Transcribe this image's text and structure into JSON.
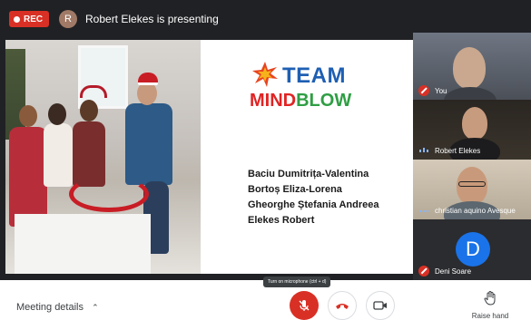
{
  "topbar": {
    "rec_label": "REC",
    "presenter_initial": "R",
    "presenting_text": "Robert Elekes is presenting"
  },
  "slide": {
    "logo_team": "TEAM",
    "logo_mind": "MIND",
    "logo_blow": "BLOW",
    "names": [
      "Baciu Dumitrița-Valentina",
      "Bortoș Eliza-Lorena",
      "Gheorghe Ștefania Andreea",
      "Elekes Robert"
    ]
  },
  "participants": [
    {
      "name": "You",
      "muted": true
    },
    {
      "name": "Robert Elekes",
      "muted": false
    },
    {
      "name": "christian aquino Avesque",
      "muted": false
    },
    {
      "name": "Deni Soare",
      "muted": true,
      "initial": "D"
    }
  ],
  "bottombar": {
    "meeting_details": "Meeting details",
    "mic_tooltip": "Turn on microphone (ctrl + d)",
    "raise_hand": "Raise hand"
  },
  "colors": {
    "rec_red": "#d93025",
    "team_blue": "#1e5fb3",
    "mind_red": "#e02424",
    "blow_green": "#2f9e44",
    "avatar_blue": "#1a73e8"
  },
  "icons": {
    "mic": "mic-off-icon",
    "hangup": "phone-hangup-icon",
    "camera": "camera-icon",
    "hand": "hand-icon",
    "chevron": "chevron-up-icon"
  }
}
